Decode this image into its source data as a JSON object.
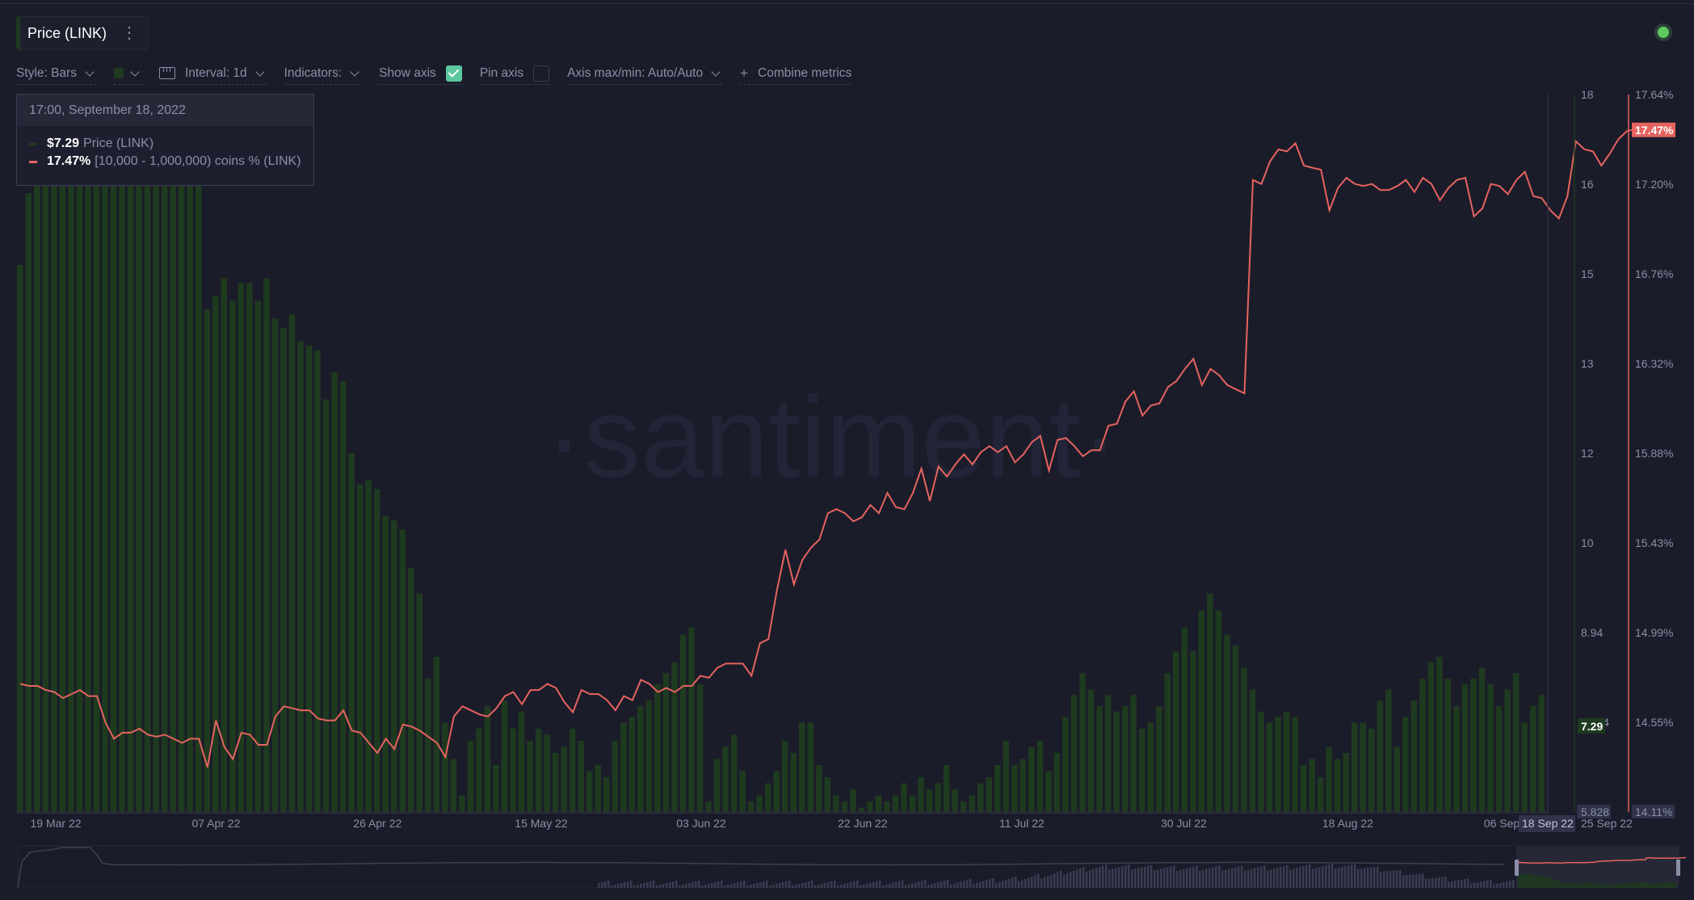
{
  "metric_chip": {
    "name": "Price (LINK)",
    "menu_icon": "vertical-dots-icon"
  },
  "status": {
    "indicator": "online",
    "color": "#5dc85e"
  },
  "toolbar": {
    "style_label": "Style: Bars",
    "color_swatch": "#1e3a1f",
    "interval_label": "Interval: 1d",
    "indicators_label": "Indicators:",
    "show_axis_label": "Show axis",
    "show_axis_checked": true,
    "pin_axis_label": "Pin axis",
    "pin_axis_checked": false,
    "axis_minmax_label": "Axis max/min: Auto/Auto",
    "combine_label": "Combine metrics"
  },
  "tooltip": {
    "datetime": "17:00, September 18, 2022",
    "rows": [
      {
        "value": "$7.29",
        "label": "Price (LINK)",
        "color": "#1e3a1f"
      },
      {
        "value": "17.47%",
        "label": "[10,000 - 1,000,000) coins % (LINK)",
        "color": "#e5635f"
      }
    ]
  },
  "watermark": "·santiment·",
  "colors": {
    "bar": "#1e3a1f",
    "line": "#e5635f",
    "background": "#1b1c2a"
  },
  "chart_data": {
    "type": "bar+line",
    "title": "Price (LINK)",
    "x_start": "2022-03-18",
    "x_end": "2022-09-18",
    "x_ticks": [
      "19 Mar 22",
      "07 Apr 22",
      "26 Apr 22",
      "15 May 22",
      "03 Jun 22",
      "22 Jun 22",
      "11 Jul 22",
      "30 Jul 22",
      "18 Aug 22",
      "06 Sep 22"
    ],
    "x_highlight_label": "18 Sep 22",
    "left_axis": {
      "label": "Price (LINK)",
      "ticks": [
        "18",
        "16",
        "15",
        "13",
        "12",
        "10",
        "8.94",
        "7.304",
        "5.828"
      ],
      "tick_values": [
        18,
        16,
        15,
        13,
        12,
        10,
        8.94,
        7.304,
        5.828
      ],
      "min": 5.828,
      "max": 18,
      "current_badge": "7.29"
    },
    "right_axis": {
      "label": "[10,000 - 1,000,000) coins % (LINK)",
      "ticks": [
        "17.64%",
        "17.20%",
        "16.76%",
        "16.32%",
        "15.88%",
        "15.43%",
        "14.99%",
        "14.55%",
        "14.11%"
      ],
      "min": 14.11,
      "max": 17.64,
      "current_badge": "17.47%"
    },
    "series": [
      {
        "name": "Price (LINK)",
        "type": "bar",
        "color": "#1e3a1f",
        "values": [
          15.1,
          15.9,
          16.3,
          16.7,
          17.0,
          16.5,
          16.9,
          17.9,
          17.4,
          18.0,
          18.0,
          18.0,
          18.0,
          18.0,
          18.0,
          17.7,
          16.6,
          16.9,
          16.2,
          16.0,
          16.4,
          16.2,
          14.2,
          14.5,
          14.9,
          14.4,
          14.8,
          14.8,
          14.4,
          14.9,
          14.0,
          13.8,
          14.1,
          13.5,
          13.4,
          13.3,
          12.6,
          12.9,
          12.8,
          12.0,
          11.3,
          11.4,
          11.2,
          10.6,
          10.5,
          10.3,
          9.7,
          9.4,
          8.1,
          8.5,
          7.3,
          6.7,
          6.1,
          7.0,
          7.2,
          7.6,
          6.6,
          7.7,
          7.2,
          7.5,
          7.0,
          7.2,
          7.1,
          6.8,
          6.9,
          7.2,
          7.0,
          6.5,
          6.6,
          6.4,
          7.0,
          7.3,
          7.4,
          7.6,
          7.7,
          8.0,
          8.2,
          8.4,
          8.9,
          9.0,
          8.0,
          6.0,
          6.7,
          6.9,
          7.1,
          6.5,
          6.0,
          6.1,
          6.3,
          6.5,
          7.0,
          6.8,
          7.3,
          7.3,
          6.6,
          6.4,
          6.1,
          6.0,
          6.2,
          5.9,
          6.0,
          6.1,
          6.0,
          6.1,
          6.3,
          6.1,
          6.4,
          6.2,
          6.3,
          6.6,
          6.2,
          6.0,
          6.1,
          6.3,
          6.4,
          6.6,
          7.0,
          6.6,
          6.7,
          6.9,
          7.0,
          6.5,
          6.8,
          7.4,
          7.8,
          8.2,
          7.9,
          7.6,
          7.8,
          7.5,
          7.6,
          7.8,
          7.2,
          7.3,
          7.6,
          8.2,
          8.6,
          9.0,
          8.6,
          9.2,
          9.4,
          9.2,
          8.9,
          8.7,
          8.3,
          7.9,
          7.5,
          7.3,
          7.4,
          7.5,
          7.4,
          6.6,
          6.7,
          6.4,
          6.9,
          6.7,
          6.8,
          7.3,
          7.3,
          7.2,
          7.7,
          7.9,
          6.9,
          7.4,
          7.7,
          8.1,
          8.4,
          8.5,
          8.1,
          7.6,
          8.0,
          8.1,
          8.3,
          8.0,
          7.6,
          7.9,
          8.2,
          7.3,
          7.6,
          7.8
        ],
        "last_value": 7.29
      },
      {
        "name": "[10,000 - 1,000,000) coins % (LINK)",
        "type": "line",
        "color": "#e5635f",
        "values": [
          14.74,
          14.73,
          14.73,
          14.71,
          14.7,
          14.67,
          14.69,
          14.71,
          14.68,
          14.68,
          14.55,
          14.47,
          14.5,
          14.5,
          14.52,
          14.49,
          14.48,
          14.49,
          14.47,
          14.45,
          14.47,
          14.47,
          14.33,
          14.56,
          14.43,
          14.37,
          14.5,
          14.49,
          14.44,
          14.44,
          14.58,
          14.63,
          14.62,
          14.61,
          14.61,
          14.57,
          14.56,
          14.56,
          14.61,
          14.51,
          14.5,
          14.45,
          14.4,
          14.47,
          14.42,
          14.54,
          14.53,
          14.51,
          14.48,
          14.45,
          14.38,
          14.58,
          14.63,
          14.61,
          14.59,
          14.58,
          14.62,
          14.68,
          14.7,
          14.64,
          14.71,
          14.71,
          14.74,
          14.72,
          14.65,
          14.6,
          14.71,
          14.69,
          14.69,
          14.66,
          14.61,
          14.68,
          14.66,
          14.76,
          14.74,
          14.7,
          14.72,
          14.7,
          14.73,
          14.73,
          14.78,
          14.77,
          14.82,
          14.84,
          14.84,
          14.84,
          14.78,
          14.94,
          14.96,
          15.2,
          15.4,
          15.23,
          15.35,
          15.41,
          15.45,
          15.58,
          15.6,
          15.58,
          15.54,
          15.56,
          15.62,
          15.58,
          15.68,
          15.61,
          15.6,
          15.68,
          15.8,
          15.64,
          15.81,
          15.76,
          15.82,
          15.87,
          15.82,
          15.88,
          15.91,
          15.88,
          15.91,
          15.83,
          15.87,
          15.93,
          15.96,
          15.79,
          15.94,
          15.95,
          15.91,
          15.86,
          15.89,
          15.89,
          16.01,
          16.02,
          16.13,
          16.18,
          16.06,
          16.11,
          16.12,
          16.2,
          16.23,
          16.29,
          16.34,
          16.21,
          16.29,
          16.26,
          16.21,
          16.19,
          16.17,
          17.22,
          17.2,
          17.31,
          17.37,
          17.36,
          17.4,
          17.29,
          17.28,
          17.27,
          17.07,
          17.18,
          17.23,
          17.2,
          17.19,
          17.2,
          17.17,
          17.17,
          17.19,
          17.22,
          17.16,
          17.23,
          17.2,
          17.12,
          17.18,
          17.22,
          17.23,
          17.04,
          17.08,
          17.2,
          17.19,
          17.15,
          17.22,
          17.26,
          17.14,
          17.13,
          17.07,
          17.03,
          17.14,
          17.41,
          17.37,
          17.36,
          17.29,
          17.35,
          17.42,
          17.46,
          17.47
        ],
        "last_value": 17.47
      }
    ]
  },
  "navigator": {
    "selected_range": "2022-03-18 to 2022-09-18"
  }
}
